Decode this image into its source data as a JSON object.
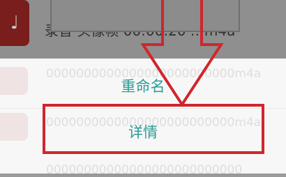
{
  "file_list": {
    "visible_row": {
      "icon": "music-note-icon",
      "filename": "录音 头像帧 00:00:20 …m4a"
    },
    "thumb_color": "#7a1d1d"
  },
  "action_sheet": {
    "items": [
      {
        "label": "重命名"
      },
      {
        "label": "详情"
      }
    ],
    "text_color": "#2b9c95",
    "ghost_lines": [
      "0000000000000000000000000m4a",
      "0000000000000000000000000m4a",
      "00000000000000000000000000"
    ]
  },
  "annotation": {
    "color": "#d0262c",
    "arrow_icon": "down-arrow-outline-icon"
  }
}
